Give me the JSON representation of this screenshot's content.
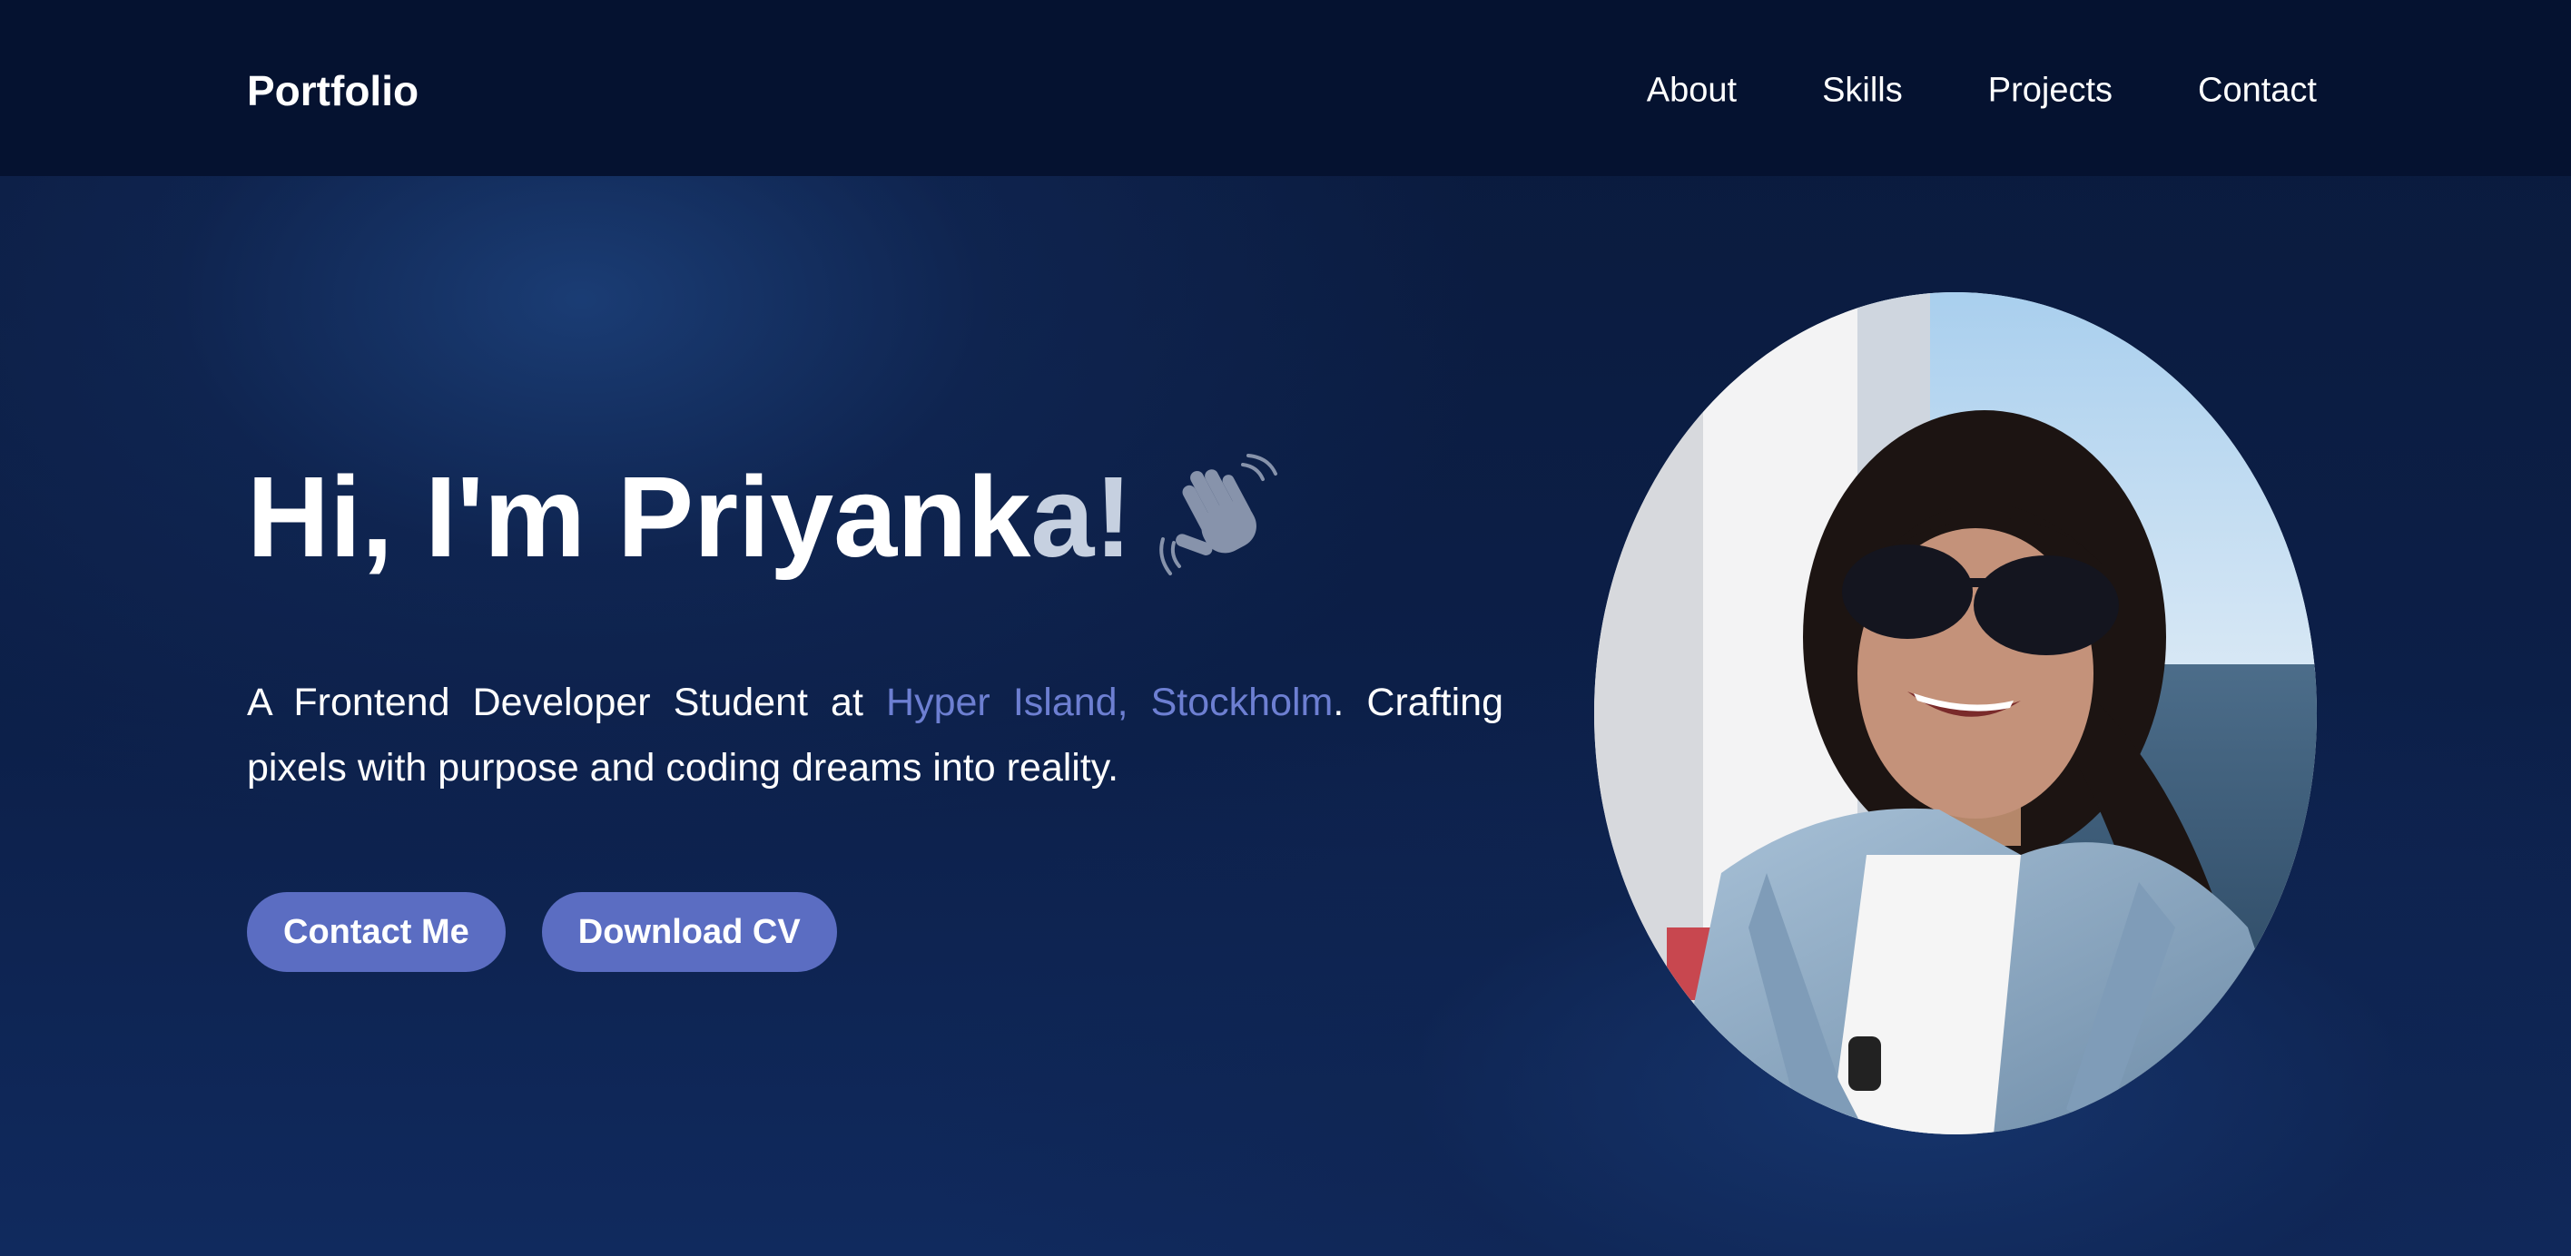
{
  "nav": {
    "brand": "Portfolio",
    "links": [
      "About",
      "Skills",
      "Projects",
      "Contact"
    ]
  },
  "hero": {
    "title_main": "Hi, I'm Priyank",
    "title_fade": "a!",
    "wave_icon": "waving-hand-icon",
    "desc_prefix": "A Frontend Developer Student at ",
    "desc_highlight": "Hyper Island, Stockholm",
    "desc_suffix": ". Crafting pixels with purpose and coding dreams into reality.",
    "buttons": {
      "contact": "Contact Me",
      "download": "Download CV"
    }
  },
  "colors": {
    "background": "#0c1f48",
    "navbar": "#051230",
    "accent": "#5b6dc2",
    "highlight_text": "#6d7fd2"
  }
}
